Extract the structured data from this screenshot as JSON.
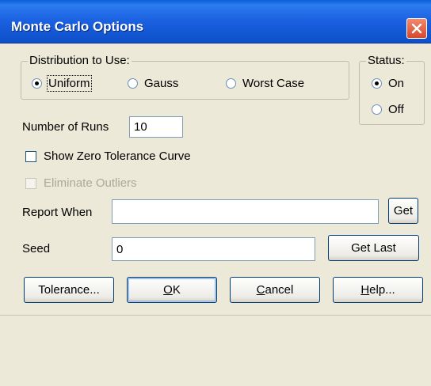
{
  "window": {
    "title": "Monte Carlo Options",
    "close_icon": "close-icon"
  },
  "distribution": {
    "group_label": "Distribution to Use:",
    "options": [
      {
        "label": "Uniform",
        "selected": true
      },
      {
        "label": "Gauss",
        "selected": false
      },
      {
        "label": "Worst Case",
        "selected": false
      }
    ]
  },
  "status": {
    "group_label": "Status:",
    "options": [
      {
        "label": "On",
        "selected": true
      },
      {
        "label": "Off",
        "selected": false
      }
    ]
  },
  "runs": {
    "label": "Number of Runs",
    "value": "10"
  },
  "show_zero": {
    "label": "Show Zero Tolerance Curve",
    "checked": false
  },
  "eliminate_outliers": {
    "label": "Eliminate Outliers",
    "checked": false,
    "enabled": false
  },
  "report_when": {
    "label": "Report When",
    "value": "",
    "button": "Get"
  },
  "seed": {
    "label": "Seed",
    "value": "0",
    "button": "Get Last"
  },
  "buttons": {
    "tolerance": "Tolerance...",
    "ok_key": "O",
    "ok_rest": "K",
    "cancel_key": "C",
    "cancel_rest": "ancel",
    "help_key": "H",
    "help_rest": "elp..."
  },
  "colors": {
    "titlebar": "#0a5fd8",
    "dialog_bg": "#ece9d8",
    "close": "#d8482a"
  }
}
